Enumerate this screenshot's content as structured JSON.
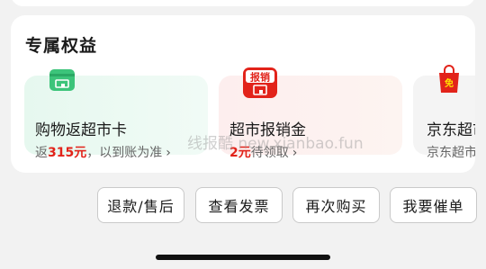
{
  "section_title": "专属权益",
  "tiles": [
    {
      "title": "购物返超市卡",
      "sub_prefix": "返",
      "amount": "315元",
      "sub_suffix": "，以到账为准",
      "chevron": "›",
      "icon": "card-icon",
      "accent": "#3cc47a"
    },
    {
      "title": "超市报销金",
      "sub_prefix": "",
      "amount": "2元",
      "sub_suffix": "待领取",
      "chevron": "›",
      "icon": "receipt-icon",
      "icon_text": "报销",
      "accent": "#e2231a"
    },
    {
      "title": "京东超市",
      "sub_text": "京东超市",
      "icon": "shopping-bag-icon",
      "icon_text": "免",
      "accent": "#e2231a"
    }
  ],
  "actions": [
    "退款/售后",
    "查看发票",
    "再次购买",
    "我要催单"
  ],
  "watermark": "线报酷 new.xianbao.fun",
  "colors": {
    "price_red": "#e2231a",
    "green": "#3cc47a"
  }
}
